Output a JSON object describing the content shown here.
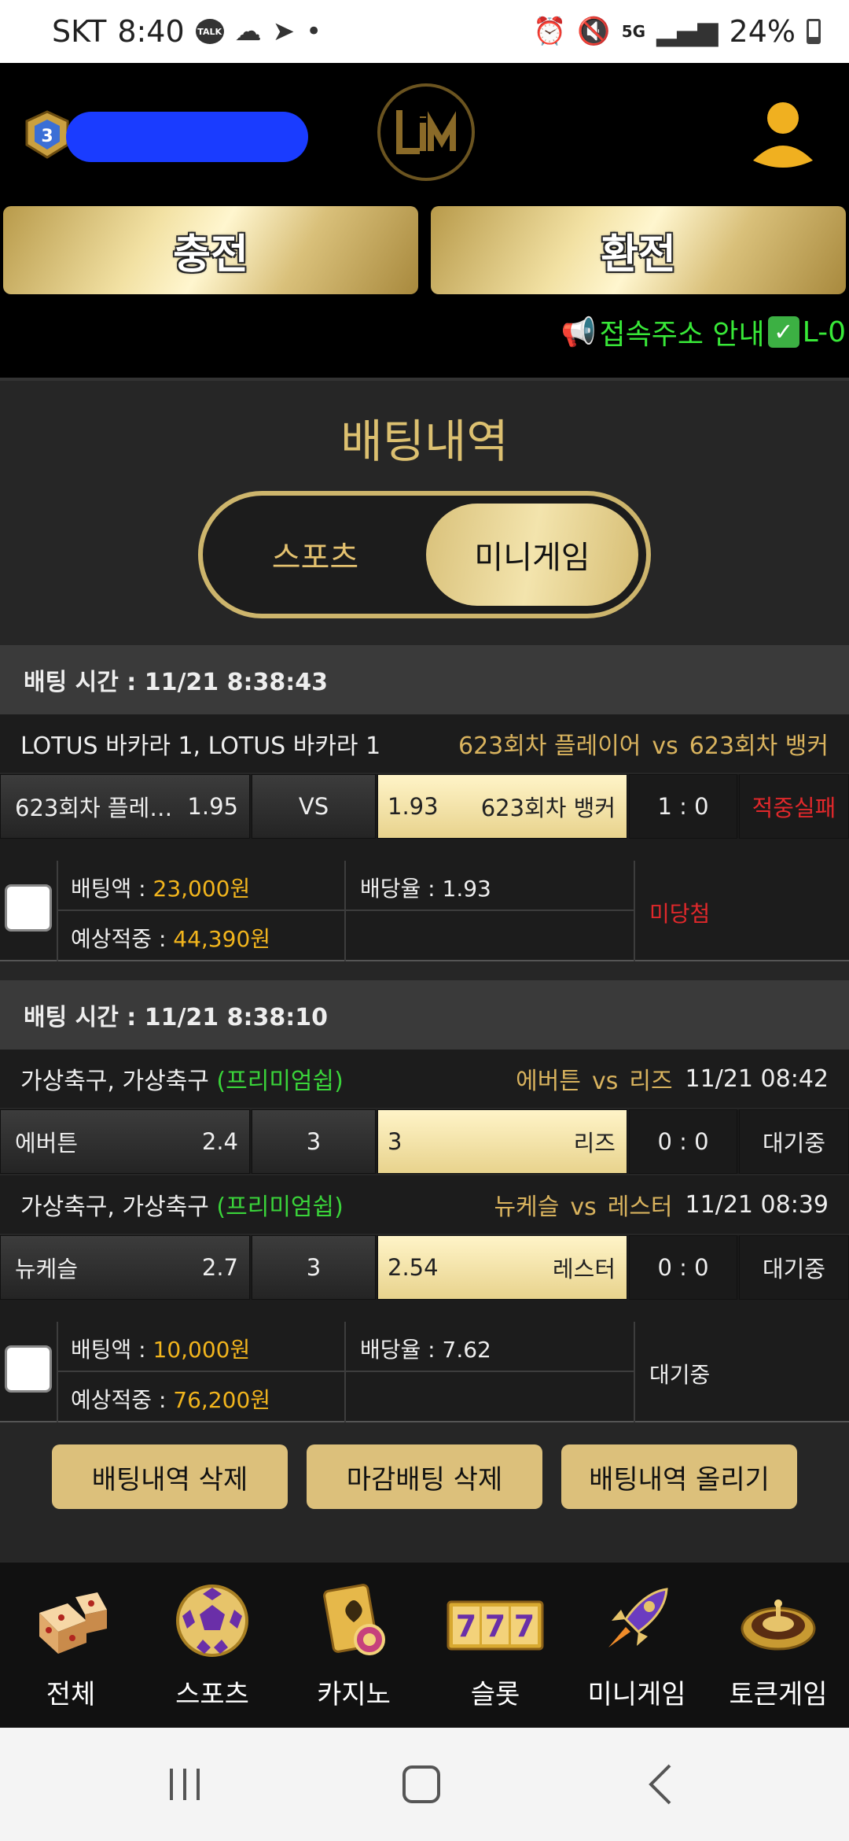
{
  "status_bar": {
    "carrier": "SKT",
    "time": "8:40",
    "talk_badge": "TALK",
    "network": "5G",
    "battery": "24%"
  },
  "header": {
    "rank_level": "3",
    "charge_label": "충전",
    "exchange_label": "환전",
    "notice_text": "접속주소 안내",
    "notice_suffix": "L-0"
  },
  "page": {
    "title": "배팅내역",
    "tabs": [
      {
        "label": "스포츠",
        "active": false
      },
      {
        "label": "미니게임",
        "active": true
      }
    ]
  },
  "bets": [
    {
      "time_label": "배팅 시간 : 11/21 8:38:43",
      "games": [
        {
          "name": "LOTUS 바카라 1, LOTUS 바카라 1",
          "premium": "",
          "home_team": "623회차 플레이어",
          "vs": "vs",
          "away_team": "623회차 뱅커",
          "game_time": "",
          "home_cell": "623회차 플레…",
          "home_odds": "1.95",
          "mid": "VS",
          "away_odds": "1.93",
          "away_cell": "623회차 뱅커",
          "score": "1 : 0",
          "status": "적중실패"
        }
      ],
      "bet_amount_label": "배팅액 : ",
      "bet_amount": "23,000원",
      "rate_label": "배당율 : 1.93",
      "expected_label": "예상적중 : ",
      "expected": "44,390원",
      "result": "미당첨"
    },
    {
      "time_label": "배팅 시간 : 11/21 8:38:10",
      "games": [
        {
          "name": "가상축구, 가상축구 ",
          "premium": "(프리미엄쉽)",
          "home_team": "에버튼",
          "vs": "vs",
          "away_team": "리즈",
          "game_time": "11/21 08:42",
          "home_cell": "에버튼",
          "home_odds": "2.4",
          "mid": "3",
          "away_odds": "3",
          "away_cell": "리즈",
          "score": "0 : 0",
          "status": "대기중"
        },
        {
          "name": "가상축구, 가상축구 ",
          "premium": "(프리미엄쉽)",
          "home_team": "뉴케슬",
          "vs": "vs",
          "away_team": "레스터",
          "game_time": "11/21 08:39",
          "home_cell": "뉴케슬",
          "home_odds": "2.7",
          "mid": "3",
          "away_odds": "2.54",
          "away_cell": "레스터",
          "score": "0 : 0",
          "status": "대기중"
        }
      ],
      "bet_amount_label": "배팅액 : ",
      "bet_amount": "10,000원",
      "rate_label": "배당율 : 7.62",
      "expected_label": "예상적중 : ",
      "expected": "76,200원",
      "result": "대기중"
    }
  ],
  "actions": {
    "delete_history": "배팅내역 삭제",
    "delete_closed": "마감배팅 삭제",
    "upload_history": "배팅내역 올리기"
  },
  "bottom_nav": [
    {
      "label": "전체",
      "icon": "dice-icon"
    },
    {
      "label": "스포츠",
      "icon": "soccer-ball-icon"
    },
    {
      "label": "카지노",
      "icon": "cards-chip-icon"
    },
    {
      "label": "슬롯",
      "icon": "slot-777-icon"
    },
    {
      "label": "미니게임",
      "icon": "rocket-icon"
    },
    {
      "label": "토큰게임",
      "icon": "roulette-icon"
    }
  ],
  "colors": {
    "gold": "#dcc07b",
    "accent_text": "#d9b35e",
    "fail_red": "#e0282b",
    "notice_green": "#38e838"
  }
}
